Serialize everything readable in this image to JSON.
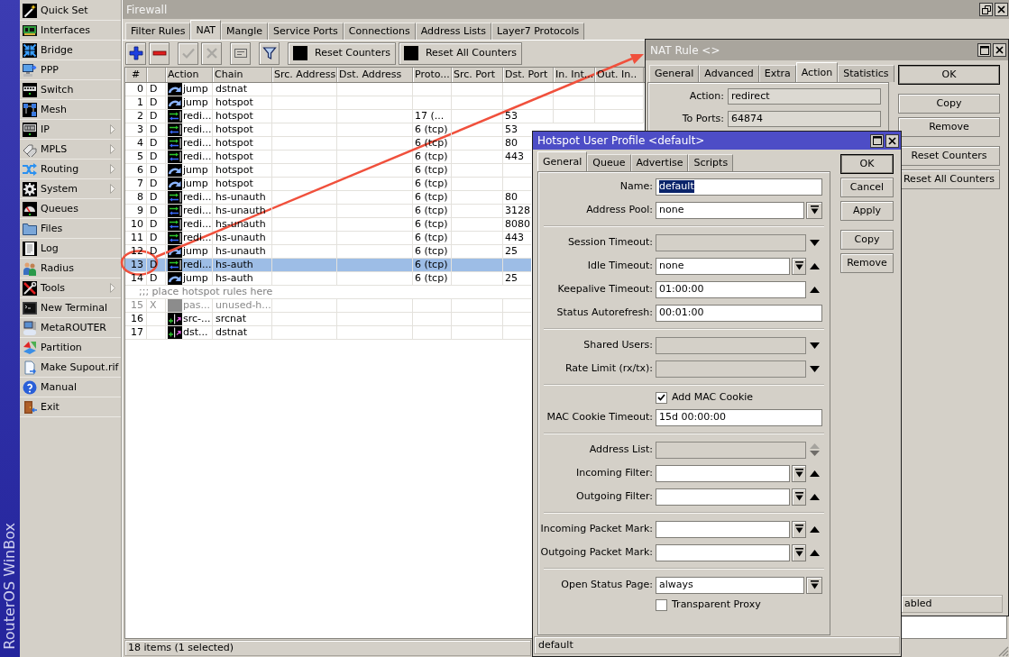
{
  "sidebar": {
    "items": [
      {
        "label": "Quick Set",
        "kind": "wand",
        "submenu": false
      },
      {
        "label": "Interfaces",
        "kind": "card",
        "submenu": false
      },
      {
        "label": "Bridge",
        "kind": "bridge",
        "submenu": false
      },
      {
        "label": "PPP",
        "kind": "ppp",
        "submenu": false
      },
      {
        "label": "Switch",
        "kind": "switch",
        "submenu": false
      },
      {
        "label": "Mesh",
        "kind": "mesh",
        "submenu": false
      },
      {
        "label": "IP",
        "kind": "ip",
        "submenu": true
      },
      {
        "label": "MPLS",
        "kind": "tags",
        "submenu": true
      },
      {
        "label": "Routing",
        "kind": "routing",
        "submenu": true
      },
      {
        "label": "System",
        "kind": "gear",
        "submenu": true
      },
      {
        "label": "Queues",
        "kind": "gauge",
        "submenu": false
      },
      {
        "label": "Files",
        "kind": "folder",
        "submenu": false
      },
      {
        "label": "Log",
        "kind": "log",
        "submenu": false
      },
      {
        "label": "Radius",
        "kind": "people",
        "submenu": false
      },
      {
        "label": "Tools",
        "kind": "tools",
        "submenu": true
      },
      {
        "label": "New Terminal",
        "kind": "terminal",
        "submenu": false
      },
      {
        "label": "MetaROUTER",
        "kind": "server",
        "submenu": false
      },
      {
        "label": "Partition",
        "kind": "partition",
        "submenu": false
      },
      {
        "label": "Make Supout.rif",
        "kind": "fileexport",
        "submenu": false
      },
      {
        "label": "Manual",
        "kind": "help",
        "submenu": false
      },
      {
        "label": "Exit",
        "kind": "door",
        "submenu": false
      }
    ],
    "brand": "RouterOS WinBox"
  },
  "firewall": {
    "title": "Firewall",
    "tabs": [
      {
        "label": "Filter Rules",
        "selected": false
      },
      {
        "label": "NAT",
        "selected": true
      },
      {
        "label": "Mangle",
        "selected": false
      },
      {
        "label": "Service Ports",
        "selected": false
      },
      {
        "label": "Connections",
        "selected": false
      },
      {
        "label": "Address Lists",
        "selected": false
      },
      {
        "label": "Layer7 Protocols",
        "selected": false
      }
    ],
    "toolbar": [
      [
        {
          "kind": "add",
          "disabled": false
        },
        {
          "kind": "remove",
          "disabled": false
        }
      ],
      [
        {
          "kind": "enable",
          "disabled": true
        },
        {
          "kind": "disable",
          "disabled": true
        }
      ],
      [
        {
          "kind": "comment",
          "disabled": false
        }
      ],
      [
        {
          "kind": "filter",
          "disabled": false
        }
      ],
      [
        {
          "kind": "reset",
          "label": "Reset Counters",
          "disabled": false
        },
        {
          "kind": "reset",
          "label": "Reset All Counters",
          "disabled": false
        }
      ]
    ],
    "table": {
      "columns": [
        "#",
        "Action",
        "Chain",
        "Src. Address",
        "Dst. Address",
        "Proto...",
        "Src. Port",
        "Dst. Port",
        "In. Int...",
        "Out. In.."
      ],
      "rows": [
        {
          "number": "0",
          "flag": "D",
          "kind": "jump",
          "action": "jump",
          "chain": "dstnat",
          "selected": false,
          "disabled": false
        },
        {
          "number": "1",
          "flag": "D",
          "kind": "jump",
          "action": "jump",
          "chain": "hotspot",
          "selected": false,
          "disabled": false
        },
        {
          "number": "2",
          "flag": "D",
          "kind": "redirect",
          "action": "redi...",
          "chain": "hotspot",
          "protocol": "17 (...",
          "dst_port": "53",
          "selected": false,
          "disabled": false
        },
        {
          "number": "3",
          "flag": "D",
          "kind": "redirect",
          "action": "redi...",
          "chain": "hotspot",
          "protocol": "6 (tcp)",
          "dst_port": "53",
          "selected": false,
          "disabled": false
        },
        {
          "number": "4",
          "flag": "D",
          "kind": "redirect",
          "action": "redi...",
          "chain": "hotspot",
          "protocol": "6 (tcp)",
          "dst_port": "80",
          "selected": false,
          "disabled": false
        },
        {
          "number": "5",
          "flag": "D",
          "kind": "redirect",
          "action": "redi...",
          "chain": "hotspot",
          "protocol": "6 (tcp)",
          "dst_port": "443",
          "selected": false,
          "disabled": false
        },
        {
          "number": "6",
          "flag": "D",
          "kind": "jump",
          "action": "jump",
          "chain": "hotspot",
          "protocol": "6 (tcp)",
          "selected": false,
          "disabled": false
        },
        {
          "number": "7",
          "flag": "D",
          "kind": "jump",
          "action": "jump",
          "chain": "hotspot",
          "protocol": "6 (tcp)",
          "selected": false,
          "disabled": false
        },
        {
          "number": "8",
          "flag": "D",
          "kind": "redirect",
          "action": "redi...",
          "chain": "hs-unauth",
          "protocol": "6 (tcp)",
          "dst_port": "80",
          "selected": false,
          "disabled": false
        },
        {
          "number": "9",
          "flag": "D",
          "kind": "redirect",
          "action": "redi...",
          "chain": "hs-unauth",
          "protocol": "6 (tcp)",
          "dst_port": "3128",
          "selected": false,
          "disabled": false
        },
        {
          "number": "10",
          "flag": "D",
          "kind": "redirect",
          "action": "redi...",
          "chain": "hs-unauth",
          "protocol": "6 (tcp)",
          "dst_port": "8080",
          "selected": false,
          "disabled": false
        },
        {
          "number": "11",
          "flag": "D",
          "kind": "redirect",
          "action": "redi...",
          "chain": "hs-unauth",
          "protocol": "6 (tcp)",
          "dst_port": "443",
          "selected": false,
          "disabled": false
        },
        {
          "number": "12",
          "flag": "D",
          "kind": "jump",
          "action": "jump",
          "chain": "hs-unauth",
          "protocol": "6 (tcp)",
          "dst_port": "25",
          "selected": false,
          "disabled": false
        },
        {
          "number": "13",
          "flag": "D",
          "kind": "redirect",
          "action": "redi...",
          "chain": "hs-auth",
          "protocol": "6 (tcp)",
          "selected": true,
          "disabled": false
        },
        {
          "number": "14",
          "flag": "D",
          "kind": "jump",
          "action": "jump",
          "chain": "hs-auth",
          "protocol": "6 (tcp)",
          "dst_port": "25",
          "selected": false,
          "disabled": false
        },
        {
          "kind": "comment",
          "comment": ";;; place hotspot rules here",
          "selected": false,
          "disabled": false
        },
        {
          "number": "15",
          "flag": "X",
          "kind": "passthrough",
          "action": "pas...",
          "chain": "unused-h...",
          "selected": false,
          "disabled": true
        },
        {
          "number": "16",
          "kind": "nat",
          "action": "src-...",
          "chain": "srcnat",
          "selected": false,
          "disabled": false
        },
        {
          "number": "17",
          "kind": "nat",
          "action": "dst...",
          "chain": "dstnat",
          "selected": false,
          "disabled": false
        }
      ]
    },
    "status": "18 items (1 selected)"
  },
  "nat_rule": {
    "title": "NAT Rule <>",
    "tabs": [
      {
        "label": "General",
        "selected": false
      },
      {
        "label": "Advanced",
        "selected": false
      },
      {
        "label": "Extra",
        "selected": false
      },
      {
        "label": "Action",
        "selected": true
      },
      {
        "label": "Statistics",
        "selected": false
      }
    ],
    "fields": [
      {
        "label": "Action:",
        "value": "redirect"
      },
      {
        "label": "To Ports:",
        "value": "64874"
      }
    ],
    "button_groups": [
      [
        {
          "label": "OK",
          "default": true
        }
      ],
      [
        {
          "label": "Copy",
          "default": false
        },
        {
          "label": "Remove",
          "default": false
        }
      ],
      [
        {
          "label": "Reset Counters",
          "default": false
        },
        {
          "label": "Reset All Counters",
          "default": false
        }
      ]
    ],
    "status": "abled"
  },
  "hotspot_profile": {
    "title": "Hotspot User Profile <default>",
    "tabs": [
      {
        "label": "General",
        "selected": true
      },
      {
        "label": "Queue",
        "selected": false
      },
      {
        "label": "Advertise",
        "selected": false
      },
      {
        "label": "Scripts",
        "selected": false
      }
    ],
    "sections": [
      {
        "fields": [
          {
            "kind": "text",
            "label": "Name:",
            "value": "default",
            "value_selected": true
          },
          {
            "kind": "combo",
            "label": "Address Pool:",
            "value": "none",
            "value_selected": false
          }
        ]
      },
      {
        "fields": [
          {
            "kind": "unset",
            "label": "Session Timeout:"
          },
          {
            "kind": "comboup",
            "label": "Idle Timeout:",
            "value": "none",
            "value_selected": false
          },
          {
            "kind": "textup",
            "label": "Keepalive Timeout:",
            "value": "01:00:00",
            "value_selected": false
          },
          {
            "kind": "text",
            "label": "Status Autorefresh:",
            "value": "00:01:00",
            "value_selected": false
          }
        ]
      },
      {
        "fields": [
          {
            "kind": "unset",
            "label": "Shared Users:"
          },
          {
            "kind": "unset",
            "label": "Rate Limit (rx/tx):"
          }
        ]
      },
      {
        "fields": [
          {
            "kind": "checkbox",
            "label": "Add MAC Cookie",
            "checked": true
          },
          {
            "kind": "text",
            "label": "MAC Cookie Timeout:",
            "value": "15d 00:00:00",
            "value_selected": false
          }
        ]
      },
      {
        "fields": [
          {
            "kind": "unsetlist",
            "label": "Address List:"
          },
          {
            "kind": "comboup",
            "label": "Incoming Filter:"
          },
          {
            "kind": "comboup",
            "label": "Outgoing Filter:"
          }
        ]
      },
      {
        "fields": [
          {
            "kind": "comboup",
            "label": "Incoming Packet Mark:"
          },
          {
            "kind": "comboup",
            "label": "Outgoing Packet Mark:"
          }
        ]
      },
      {
        "fields": [
          {
            "kind": "combo",
            "label": "Open Status Page:",
            "value": "always",
            "value_selected": false
          },
          {
            "kind": "checkbox",
            "label": "Transparent Proxy",
            "checked": false
          }
        ]
      }
    ],
    "button_groups": [
      [
        {
          "label": "OK",
          "default": true
        },
        {
          "label": "Cancel",
          "default": false
        },
        {
          "label": "Apply",
          "default": false
        }
      ],
      [
        {
          "label": "Copy",
          "default": false
        },
        {
          "label": "Remove",
          "default": false
        }
      ]
    ],
    "status": "default"
  }
}
